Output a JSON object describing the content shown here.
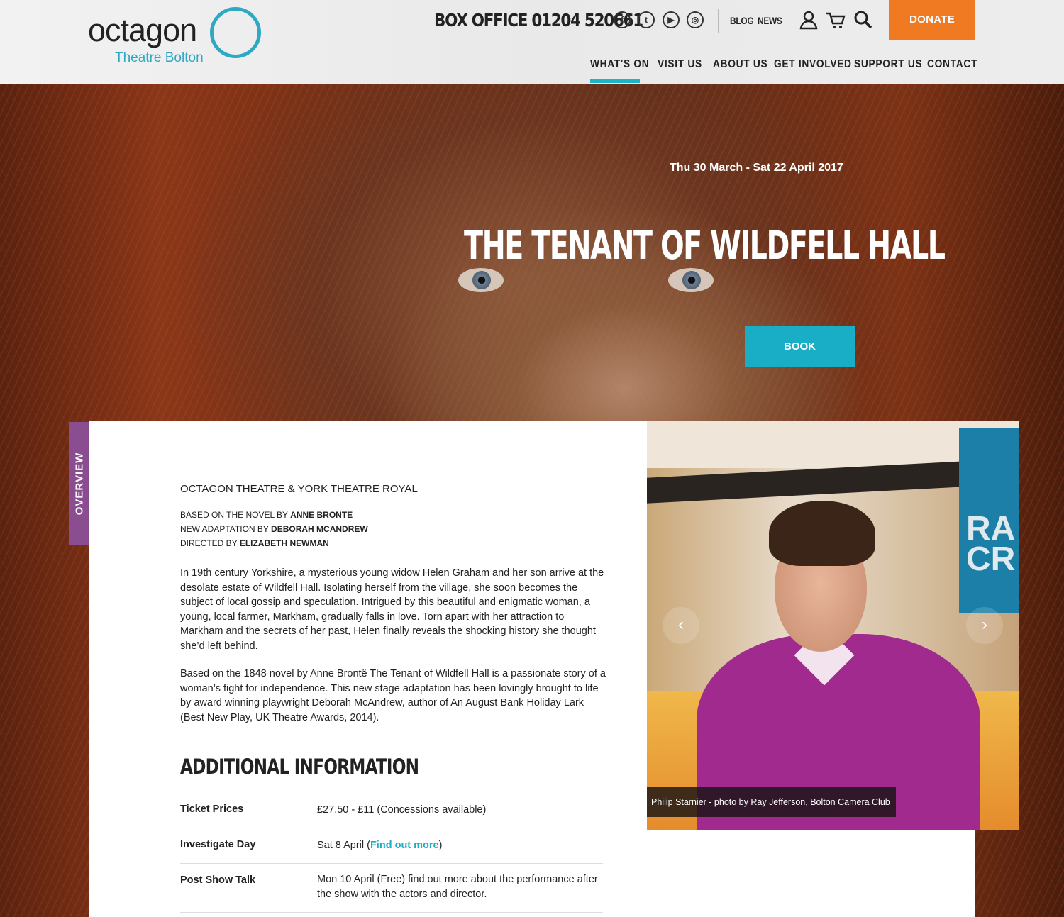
{
  "brand": {
    "name": "octagon",
    "subtitle": "Theatre Bolton",
    "accent": "#2fa9c3"
  },
  "header": {
    "box_office": "BOX OFFICE 01204 520661",
    "social": [
      "facebook-icon",
      "twitter-icon",
      "youtube-icon",
      "instagram-icon"
    ],
    "links": {
      "blog": "BLOG",
      "news": "NEWS"
    },
    "donate": "DONATE",
    "donate_color": "#f07a22"
  },
  "nav": {
    "items": [
      "WHAT'S ON",
      "VISIT US",
      "ABOUT US",
      "GET INVOLVED",
      "SUPPORT US",
      "CONTACT"
    ],
    "active": "WHAT'S ON"
  },
  "hero": {
    "dates": "Thu 30 March - Sat 22 April 2017",
    "title": "THE TENANT OF WILDFELL HALL",
    "book": "BOOK"
  },
  "overview": {
    "tab": "OVERVIEW",
    "producers": "OCTAGON THEATRE & YORK THEATRE ROYAL",
    "credits": [
      {
        "prefix": "BASED ON THE NOVEL BY",
        "name": "ANNE BRONTE"
      },
      {
        "prefix": "NEW ADAPTATION BY",
        "name": "DEBORAH MCANDREW"
      },
      {
        "prefix": "DIRECTED BY",
        "name": "ELIZABETH NEWMAN"
      }
    ],
    "para1": "In 19th century Yorkshire, a mysterious young widow Helen Graham and her son arrive at the desolate estate of Wildfell Hall. Isolating herself from the village, she soon becomes the subject of local gossip and speculation. Intrigued by this beautiful and enigmatic woman, a young, local farmer, Markham, gradually falls in love. Torn apart with her attraction to Markham and the secrets of her past, Helen finally reveals the shocking history she thought she’d left behind.",
    "para2": "Based on the 1848 novel by Anne Brontë The Tenant of Wildfell Hall is a passionate story of a woman’s fight for independence. This new stage adaptation has been lovingly brought to life by award winning playwright Deborah McAndrew, author of An August Bank Holiday Lark (Best New Play, UK Theatre Awards, 2014)."
  },
  "additional": {
    "heading": "ADDITIONAL INFORMATION",
    "rows": [
      {
        "label": "Ticket Prices",
        "value": "£27.50 - £11 (Concessions available)"
      },
      {
        "label": "Investigate Day",
        "value_before": "Sat 8 April (",
        "link": "Find out more",
        "value_after": ")"
      },
      {
        "label": "Post Show Talk",
        "value": "Mon 10 April (Free) find out more about the performance after the show with the actors and director."
      }
    ]
  },
  "gallery": {
    "caption": "Philip Starnier - photo by Ray Jefferson, Bolton Camera Club",
    "prev": "‹",
    "next": "›"
  }
}
